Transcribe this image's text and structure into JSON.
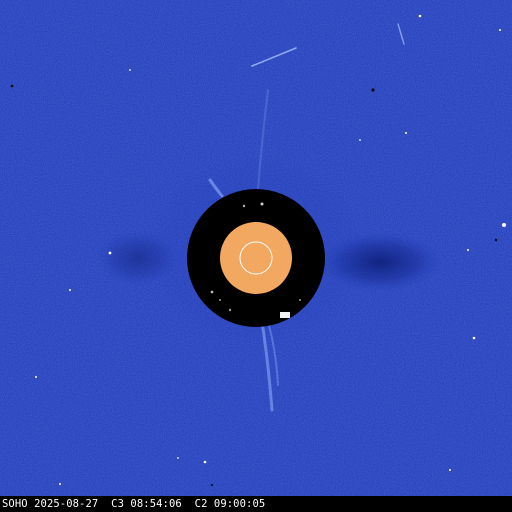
{
  "caption": "SOHO 2025-08-27  C3 08:54:06  C2 09:00:05",
  "colors": {
    "background": "#1f3ab8",
    "occulter": "#000000",
    "sun_disk": "#f2a860",
    "sun_outline": "#ffffff",
    "caption_bar": "#000000",
    "caption_text": "#ffffff"
  }
}
